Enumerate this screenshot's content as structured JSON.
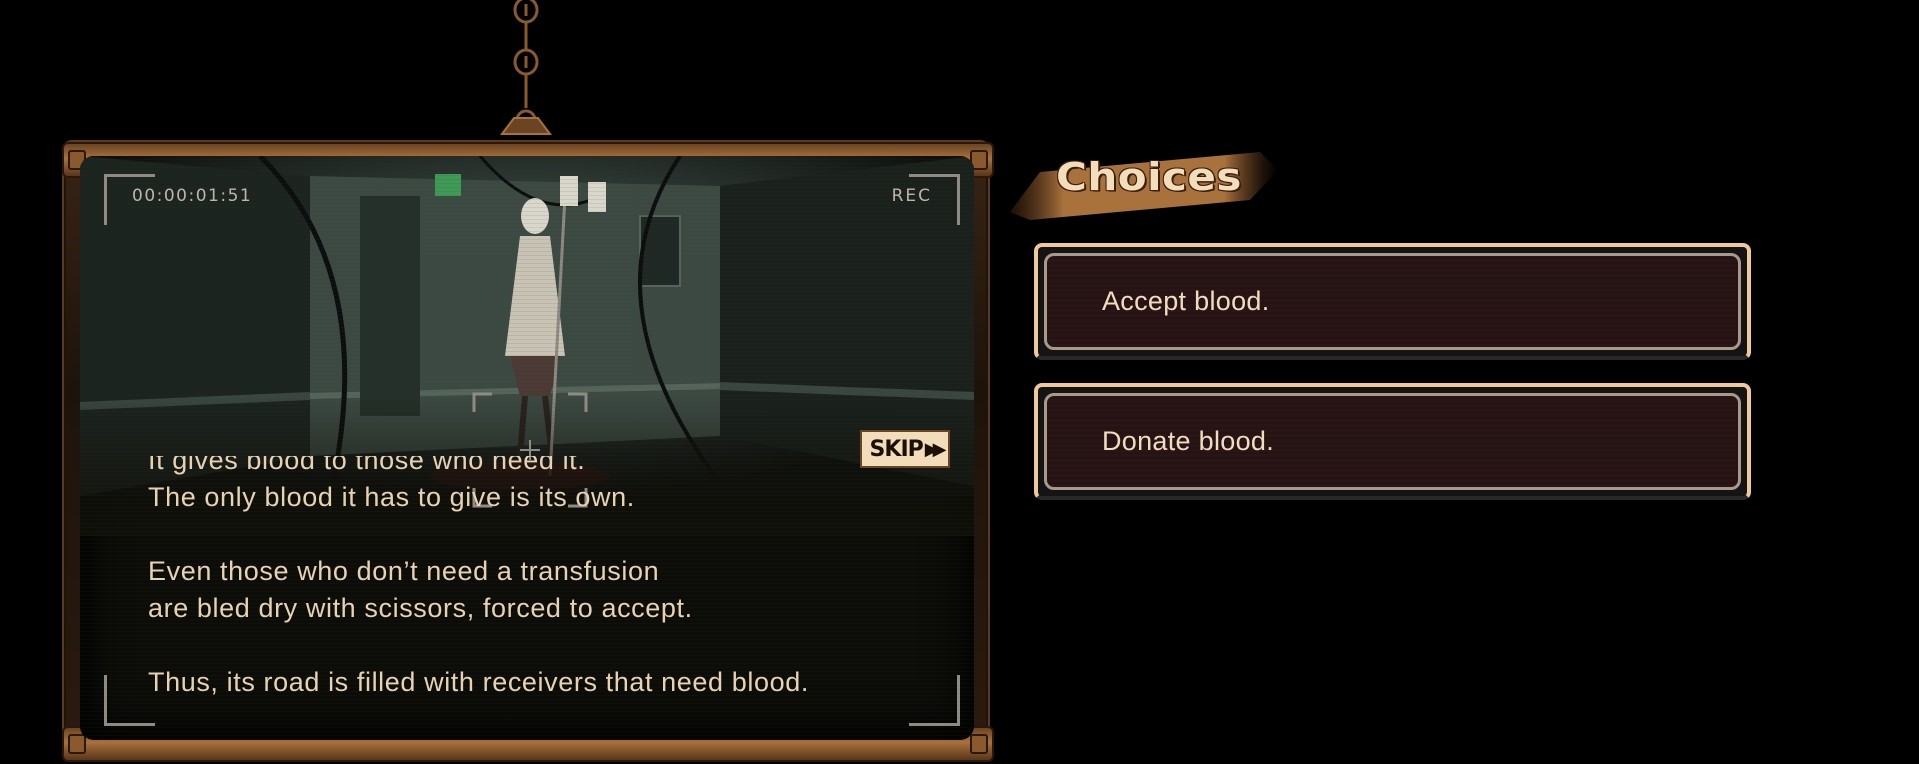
{
  "video": {
    "timecode": "00:00:01:51",
    "rec_label": "REC",
    "skip_label": "SKIP",
    "skip_icon": "fast-forward-icon",
    "narration": [
      "It gives blood to those who need it.",
      "The only blood it has to give is its own.",
      "",
      "Even those who don’t need a transfusion",
      "are bled dry with scissors, forced to accept.",
      "",
      "Thus, its road is filled with receivers that need blood."
    ]
  },
  "choices": {
    "title": "Choices",
    "options": [
      {
        "label": "Accept blood."
      },
      {
        "label": "Donate blood."
      }
    ]
  },
  "colors": {
    "accent_copper": "#a9713c",
    "text_cream": "#e7d3b4",
    "choice_border": "#f0c89a",
    "choice_fill": "#2a1516"
  }
}
